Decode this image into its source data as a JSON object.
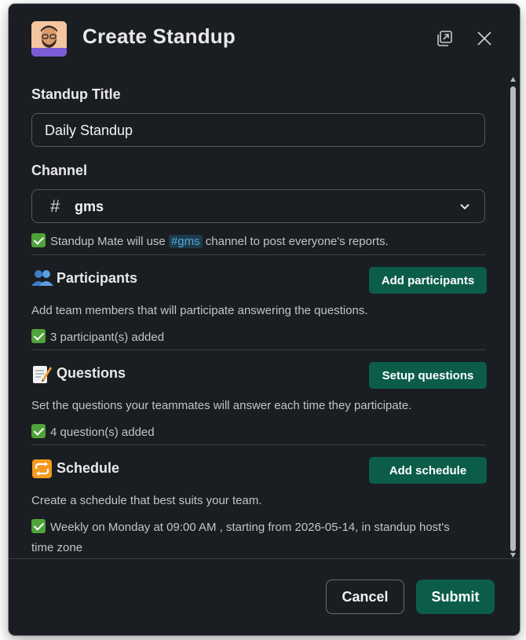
{
  "header": {
    "title": "Create Standup",
    "avatar_icon": "bearded-man-avatar",
    "expand_icon": "open-in-window-icon",
    "close_icon": "close-icon"
  },
  "form": {
    "standup_title_label": "Standup Title",
    "standup_title_value": "Daily Standup",
    "channel_label": "Channel",
    "channel_value": "gms",
    "channel_note_prefix": "Standup Mate will use",
    "channel_note_chip": "#gms",
    "channel_note_suffix": "channel to post everyone's reports."
  },
  "sections": {
    "participants": {
      "title": "Participants",
      "button": "Add participants",
      "description": "Add team members that will participate answering the questions.",
      "status": "3 participant(s) added"
    },
    "questions": {
      "title": "Questions",
      "button": "Setup questions",
      "description": "Set the questions your teammates will answer each time they participate.",
      "status": "4 question(s) added"
    },
    "schedule": {
      "title": "Schedule",
      "button": "Add schedule",
      "description": "Create a schedule that best suits your team.",
      "status_line1": "Weekly on Monday at 09:00 AM , starting from 2026-05-14, in standup host's",
      "status_line2": "time zone"
    }
  },
  "footer": {
    "cancel": "Cancel",
    "submit": "Submit"
  },
  "colors": {
    "modal_bg": "#1a1d21",
    "accent_green": "#0b5d4a",
    "check_green": "#4fa33a",
    "link_blue": "#4da8d8"
  }
}
